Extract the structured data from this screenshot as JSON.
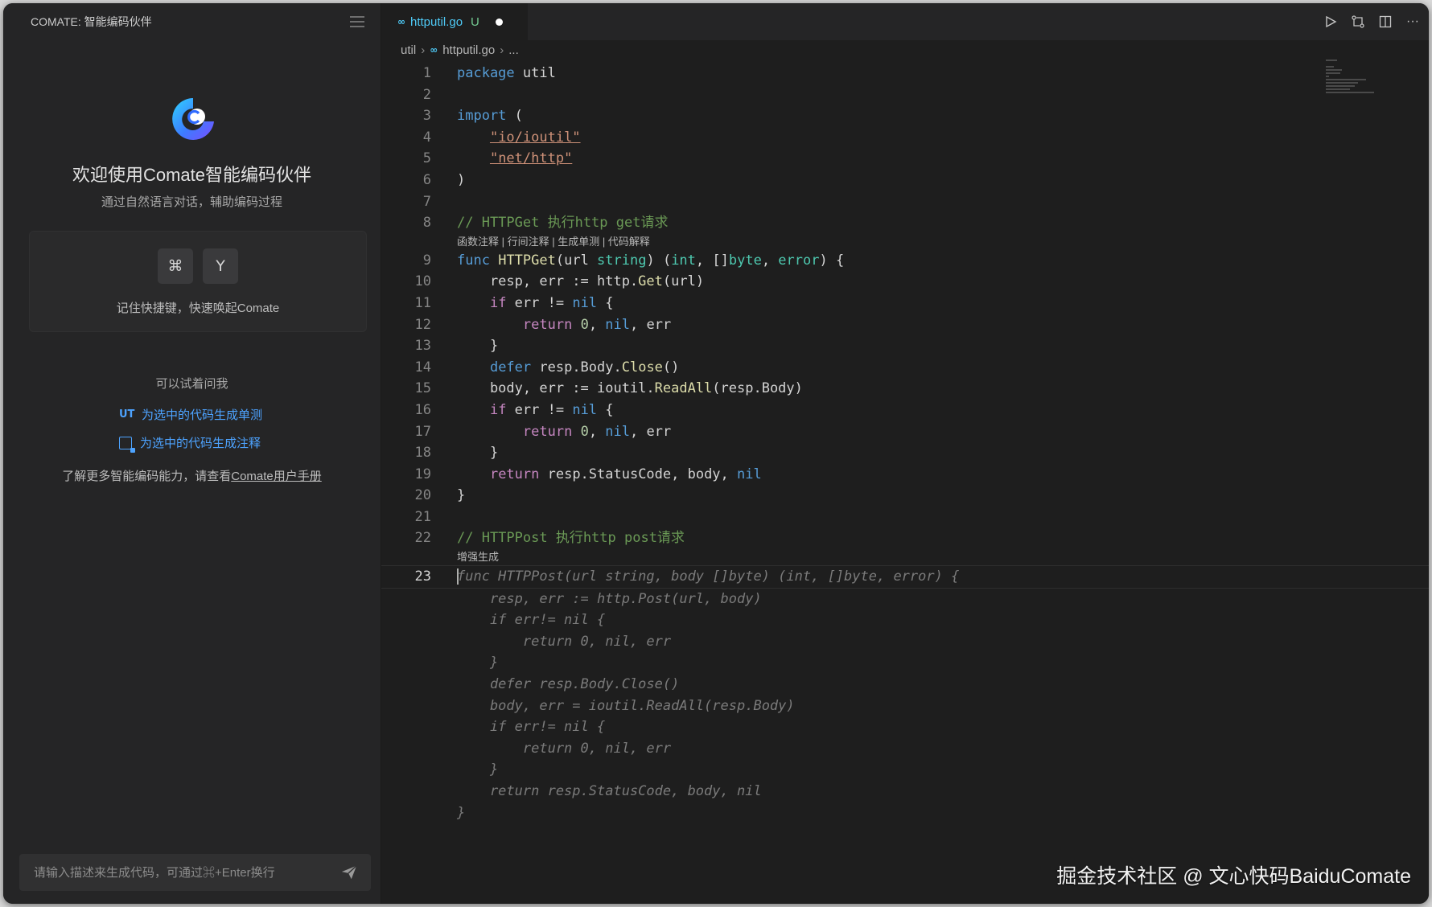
{
  "sidebar": {
    "header_title": "COMATE: 智能编码伙伴",
    "welcome_title": "欢迎使用Comate智能编码伙伴",
    "welcome_subtitle": "通过自然语言对话，辅助编码过程",
    "shortcut_keys": [
      "⌘",
      "Y"
    ],
    "shortcut_caption": "记住快捷键，快速唤起Comate",
    "try_ask": "可以试着问我",
    "suggestions": [
      {
        "icon": "UT",
        "label": "为选中的代码生成单测"
      },
      {
        "icon": "note-icon",
        "label": "为选中的代码生成注释"
      }
    ],
    "learn_more_prefix": "了解更多智能编码能力，请查看",
    "learn_more_link": "Comate用户手册",
    "input_placeholder": "请输入描述来生成代码，可通过⌘+Enter换行"
  },
  "editor": {
    "tab": {
      "icon": "go-icon",
      "name": "httputil.go",
      "status": "U"
    },
    "breadcrumb": [
      "util",
      "httputil.go",
      "..."
    ],
    "codelens_1": "函数注释 | 行间注释 | 生成单测 | 代码解释",
    "codelens_2": "增强生成",
    "active_line": 23,
    "lines": [
      "package util",
      "",
      "import (",
      "    \"io/ioutil\"",
      "    \"net/http\"",
      ")",
      "",
      "// HTTPGet 执行http get请求",
      "func HTTPGet(url string) (int, []byte, error) {",
      "    resp, err := http.Get(url)",
      "    if err != nil {",
      "        return 0, nil, err",
      "    }",
      "    defer resp.Body.Close()",
      "    body, err := ioutil.ReadAll(resp.Body)",
      "    if err != nil {",
      "        return 0, nil, err",
      "    }",
      "    return resp.StatusCode, body, nil",
      "}",
      "",
      "// HTTPPost 执行http post请求",
      "func HTTPPost(url string, body []byte) (int, []byte, error) {"
    ],
    "ghost_lines": [
      "    resp, err := http.Post(url, body)",
      "    if err!= nil {",
      "        return 0, nil, err",
      "    }",
      "    defer resp.Body.Close()",
      "    body, err = ioutil.ReadAll(resp.Body)",
      "    if err!= nil {",
      "        return 0, nil, err",
      "    }",
      "    return resp.StatusCode, body, nil",
      "}"
    ]
  },
  "watermark": "掘金技术社区 @ 文心快码BaiduComate",
  "colors": {
    "accent": "#4da3ff",
    "tab_name": "#4ec9f5",
    "untracked": "#73c991"
  }
}
